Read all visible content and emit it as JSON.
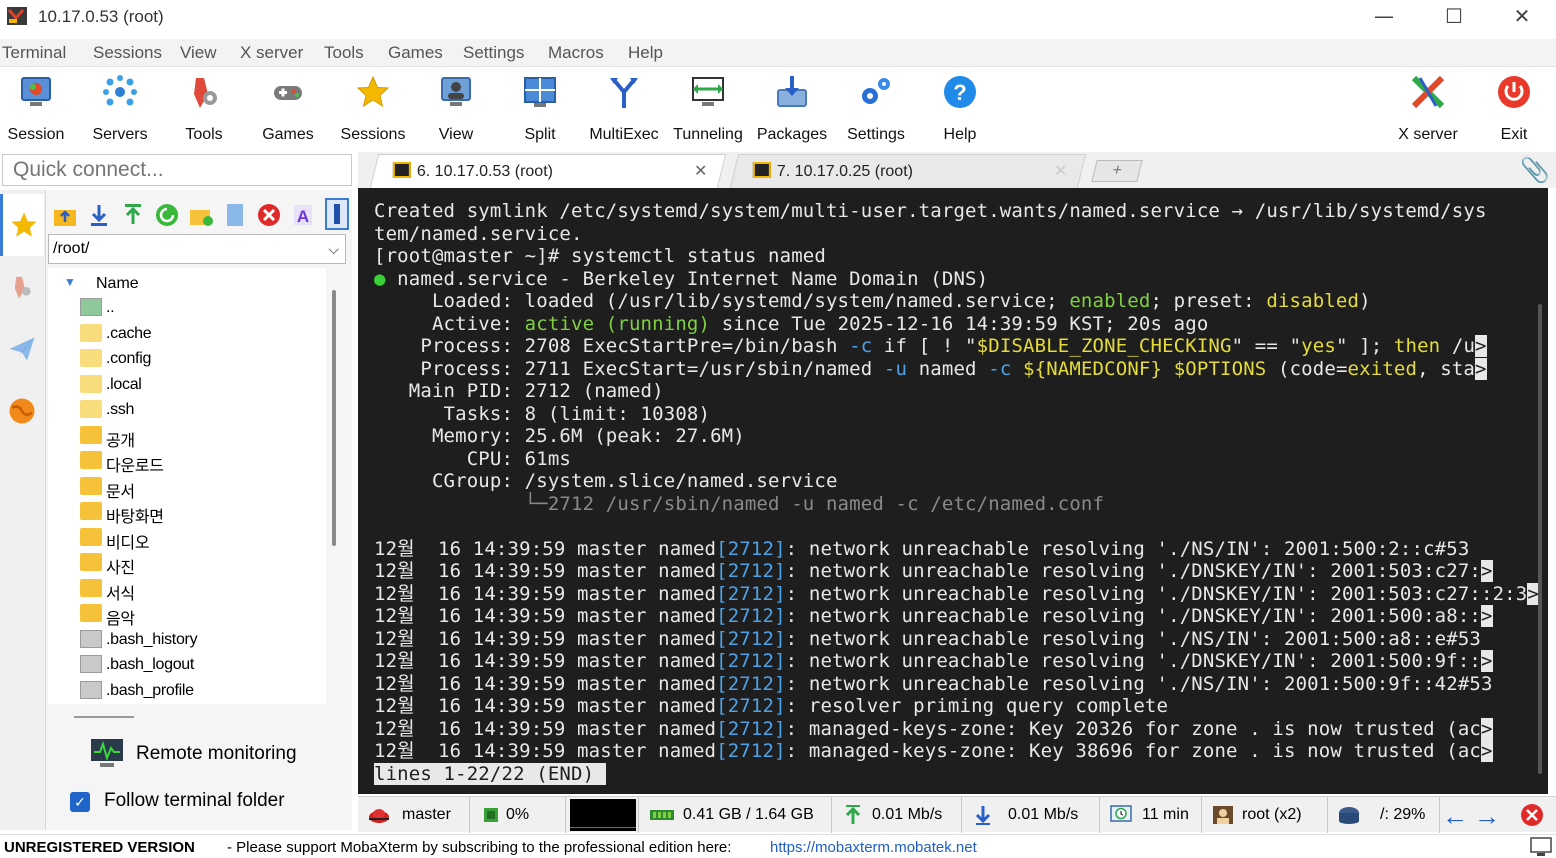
{
  "window": {
    "title": "10.17.0.53 (root)",
    "minimize": "—",
    "maximize": "☐",
    "close": "✕"
  },
  "menu": [
    "Terminal",
    "Sessions",
    "View",
    "X server",
    "Tools",
    "Games",
    "Settings",
    "Macros",
    "Help"
  ],
  "toolbar": [
    {
      "label": "Session",
      "icon": "session-icon"
    },
    {
      "label": "Servers",
      "icon": "servers-icon"
    },
    {
      "label": "Tools",
      "icon": "tools-icon"
    },
    {
      "label": "Games",
      "icon": "games-icon"
    },
    {
      "label": "Sessions",
      "icon": "star-icon"
    },
    {
      "label": "View",
      "icon": "view-icon"
    },
    {
      "label": "Split",
      "icon": "split-icon"
    },
    {
      "label": "MultiExec",
      "icon": "multiexec-icon"
    },
    {
      "label": "Tunneling",
      "icon": "tunneling-icon"
    },
    {
      "label": "Packages",
      "icon": "packages-icon"
    },
    {
      "label": "Settings",
      "icon": "settings-icon"
    },
    {
      "label": "Help",
      "icon": "help-icon"
    },
    {
      "label": "X server",
      "icon": "xserver-icon"
    },
    {
      "label": "Exit",
      "icon": "exit-icon"
    }
  ],
  "quick_connect": {
    "placeholder": "Quick connect..."
  },
  "sidebar": {
    "path": "/root/",
    "column_header": "Name",
    "files": [
      {
        "name": "..",
        "type": "up"
      },
      {
        "name": ".cache",
        "type": "folder-light"
      },
      {
        "name": ".config",
        "type": "folder-light"
      },
      {
        "name": ".local",
        "type": "folder-light"
      },
      {
        "name": ".ssh",
        "type": "folder-light"
      },
      {
        "name": "공개",
        "type": "folder"
      },
      {
        "name": "다운로드",
        "type": "folder"
      },
      {
        "name": "문서",
        "type": "folder"
      },
      {
        "name": "바탕화면",
        "type": "folder"
      },
      {
        "name": "비디오",
        "type": "folder"
      },
      {
        "name": "사진",
        "type": "folder"
      },
      {
        "name": "서식",
        "type": "folder"
      },
      {
        "name": "음악",
        "type": "folder"
      },
      {
        "name": ".bash_history",
        "type": "file"
      },
      {
        "name": ".bash_logout",
        "type": "file"
      },
      {
        "name": ".bash_profile",
        "type": "file"
      }
    ],
    "remote_monitoring": "Remote monitoring",
    "follow_folder": "Follow terminal folder",
    "follow_checked": true
  },
  "tabs": [
    {
      "label": "6. 10.17.0.53 (root)",
      "active": true,
      "close": "✕"
    },
    {
      "label": "7. 10.17.0.25 (root)",
      "active": false,
      "close": "✕"
    }
  ],
  "new_tab": "+",
  "terminal": {
    "lines": [
      [
        {
          "t": "Created symlink /etc/systemd/system/multi-user.target.wants/named.service → /usr/lib/systemd/sys"
        }
      ],
      [
        {
          "t": "tem/named.service."
        }
      ],
      [
        {
          "t": "[root@master ~]# systemctl status named"
        }
      ],
      [
        {
          "t": "●",
          "c": "dot"
        },
        {
          "t": " named.service - Berkeley Internet Name Domain (DNS)"
        }
      ],
      [
        {
          "t": "     Loaded: loaded (/usr/lib/systemd/system/named.service; "
        },
        {
          "t": "enabled",
          "c": "g"
        },
        {
          "t": "; preset: "
        },
        {
          "t": "disabled",
          "c": "y"
        },
        {
          "t": ")"
        }
      ],
      [
        {
          "t": "     Active: "
        },
        {
          "t": "active (running)",
          "c": "g"
        },
        {
          "t": " since Tue 2025-12-16 14:39:59 KST; 20s ago"
        }
      ],
      [
        {
          "t": "    Process: 2708 ExecStartPre=/bin/bash "
        },
        {
          "t": "-c",
          "c": "b"
        },
        {
          "t": " if [ ! \""
        },
        {
          "t": "$DISABLE_ZONE_CHECKING",
          "c": "y"
        },
        {
          "t": "\" == \""
        },
        {
          "t": "yes",
          "c": "y"
        },
        {
          "t": "\" ]; "
        },
        {
          "t": "then",
          "c": "y"
        },
        {
          "t": " /u"
        },
        {
          "t": ">",
          "c": "trunc"
        }
      ],
      [
        {
          "t": "    Process: 2711 ExecStart=/usr/sbin/named "
        },
        {
          "t": "-u",
          "c": "b"
        },
        {
          "t": " named "
        },
        {
          "t": "-c",
          "c": "b"
        },
        {
          "t": " "
        },
        {
          "t": "${NAMEDCONF}",
          "c": "y"
        },
        {
          "t": " "
        },
        {
          "t": "$OPTIONS",
          "c": "y"
        },
        {
          "t": " (code="
        },
        {
          "t": "exited",
          "c": "y"
        },
        {
          "t": ", sta"
        },
        {
          "t": ">",
          "c": "trunc"
        }
      ],
      [
        {
          "t": "   Main PID: 2712 (named)"
        }
      ],
      [
        {
          "t": "      Tasks: 8 (limit: 10308)"
        }
      ],
      [
        {
          "t": "     Memory: 25.6M (peak: 27.6M)"
        }
      ],
      [
        {
          "t": "        CPU: 61ms"
        }
      ],
      [
        {
          "t": "     CGroup: /system.slice/named.service"
        }
      ],
      [
        {
          "t": "             └─2712 /usr/sbin/named -u named -c /etc/named.conf",
          "c": "grey"
        }
      ],
      [
        {
          "t": ""
        }
      ],
      [
        {
          "t": "12월  16 14:39:59 master named"
        },
        {
          "t": "[2712]",
          "c": "b"
        },
        {
          "t": ": network unreachable resolving './NS/IN': 2001:500:2::c#53"
        }
      ],
      [
        {
          "t": "12월  16 14:39:59 master named"
        },
        {
          "t": "[2712]",
          "c": "b"
        },
        {
          "t": ": network unreachable resolving './DNSKEY/IN': 2001:503:c27:"
        },
        {
          "t": ">",
          "c": "trunc"
        }
      ],
      [
        {
          "t": "12월  16 14:39:59 master named"
        },
        {
          "t": "[2712]",
          "c": "b"
        },
        {
          "t": ": network unreachable resolving './DNSKEY/IN': 2001:503:c27::2:3"
        },
        {
          "t": ">",
          "c": "trunc"
        }
      ],
      [
        {
          "t": "12월  16 14:39:59 master named"
        },
        {
          "t": "[2712]",
          "c": "b"
        },
        {
          "t": ": network unreachable resolving './DNSKEY/IN': 2001:500:a8::"
        },
        {
          "t": ">",
          "c": "trunc"
        }
      ],
      [
        {
          "t": "12월  16 14:39:59 master named"
        },
        {
          "t": "[2712]",
          "c": "b"
        },
        {
          "t": ": network unreachable resolving './NS/IN': 2001:500:a8::e#53"
        }
      ],
      [
        {
          "t": "12월  16 14:39:59 master named"
        },
        {
          "t": "[2712]",
          "c": "b"
        },
        {
          "t": ": network unreachable resolving './DNSKEY/IN': 2001:500:9f::"
        },
        {
          "t": ">",
          "c": "trunc"
        }
      ],
      [
        {
          "t": "12월  16 14:39:59 master named"
        },
        {
          "t": "[2712]",
          "c": "b"
        },
        {
          "t": ": network unreachable resolving './NS/IN': 2001:500:9f::42#53"
        }
      ],
      [
        {
          "t": "12월  16 14:39:59 master named"
        },
        {
          "t": "[2712]",
          "c": "b"
        },
        {
          "t": ": resolver priming query complete"
        }
      ],
      [
        {
          "t": "12월  16 14:39:59 master named"
        },
        {
          "t": "[2712]",
          "c": "b"
        },
        {
          "t": ": managed-keys-zone: Key 20326 for zone . is now trusted (ac"
        },
        {
          "t": ">",
          "c": "trunc"
        }
      ],
      [
        {
          "t": "12월  16 14:39:59 master named"
        },
        {
          "t": "[2712]",
          "c": "b"
        },
        {
          "t": ": managed-keys-zone: Key 38696 for zone . is now trusted (ac"
        },
        {
          "t": ">",
          "c": "trunc"
        }
      ],
      [
        {
          "t": "lines 1-22/22 (END)",
          "c": "inv"
        },
        {
          "t": " ",
          "c": "inv"
        }
      ]
    ]
  },
  "status": {
    "host": "master",
    "cpu": "0%",
    "memory": "0.41 GB / 1.64 GB",
    "upload": "0.01 Mb/s",
    "download": "0.01 Mb/s",
    "uptime": "11 min",
    "users": "root (x2)",
    "disk": "/: 29%"
  },
  "footer": {
    "version": "UNREGISTERED VERSION",
    "message": "-  Please support MobaXterm by subscribing to the professional edition here:",
    "link": "https://mobaxterm.mobatek.net"
  },
  "colors": {
    "accent": "#1f64c8",
    "terminal_bg": "#1e1e1e",
    "green": "#7fd140",
    "yellow": "#e5dc3a",
    "blue": "#4da3e8"
  }
}
